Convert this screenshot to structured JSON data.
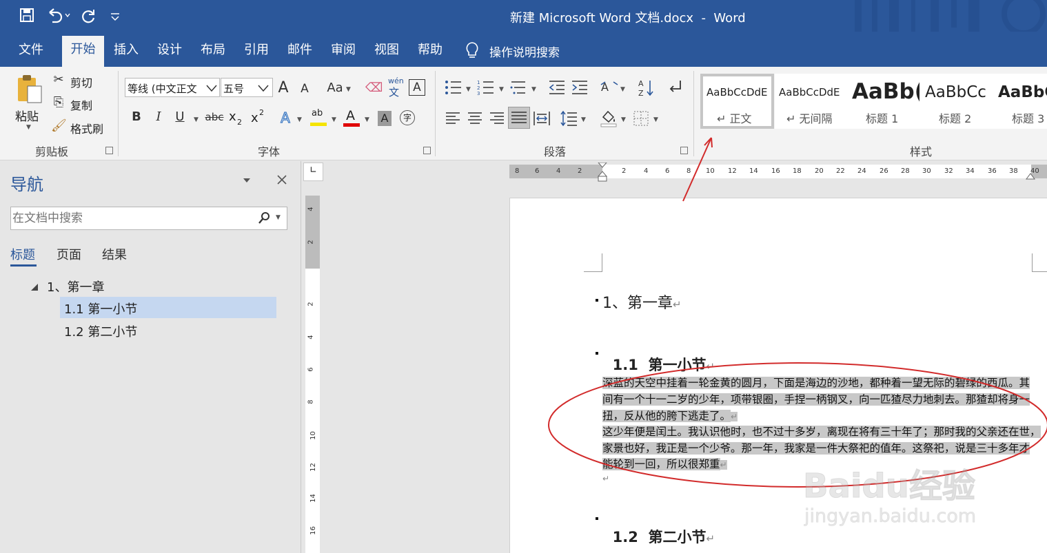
{
  "app": {
    "title": "新建 Microsoft Word 文档.docx  -  Word",
    "accent": "#2b579a"
  },
  "quick_access": {
    "save_icon": "save-icon",
    "undo_icon": "undo-icon",
    "redo_icon": "redo-icon",
    "customize_icon": "chevron-down-icon"
  },
  "tabs": [
    {
      "label": "文件"
    },
    {
      "label": "开始"
    },
    {
      "label": "插入"
    },
    {
      "label": "设计"
    },
    {
      "label": "布局"
    },
    {
      "label": "引用"
    },
    {
      "label": "邮件"
    },
    {
      "label": "审阅"
    },
    {
      "label": "视图"
    },
    {
      "label": "帮助"
    }
  ],
  "tell_me": "操作说明搜索",
  "ribbon": {
    "clipboard": {
      "group_label": "剪贴板",
      "paste": "粘贴",
      "cut": "剪切",
      "copy": "复制",
      "format_painter": "格式刷"
    },
    "font": {
      "group_label": "字体",
      "font_name": "等线 (中文正文",
      "font_size": "五号",
      "grow": "A",
      "shrink": "A",
      "change_case": "Aa",
      "phonetic_top": "wén",
      "phonetic_bottom": "文",
      "char_border": "A",
      "bold": "B",
      "italic": "I",
      "underline": "U",
      "strike": "abc",
      "subscript": "x",
      "subscript_mark": "2",
      "superscript": "x",
      "superscript_mark": "2",
      "text_effects": "A",
      "highlight": "ab",
      "font_color": "A",
      "char_shading": "A",
      "enclose": "字"
    },
    "paragraph": {
      "group_label": "段落"
    },
    "styles": {
      "group_label": "样式",
      "items": [
        {
          "preview": "AaBbCcDdE",
          "name": "↵ 正文"
        },
        {
          "preview": "AaBbCcDdE",
          "name": "↵ 无间隔"
        },
        {
          "preview": "AaBb(",
          "name": "标题 1"
        },
        {
          "preview": "AaBbCc",
          "name": "标题 2"
        },
        {
          "preview": "AaBbC",
          "name": "标题 3"
        }
      ]
    }
  },
  "nav_pane": {
    "title": "导航",
    "search_placeholder": "在文档中搜索",
    "tabs": [
      {
        "label": "标题"
      },
      {
        "label": "页面"
      },
      {
        "label": "结果"
      }
    ],
    "tree": [
      {
        "label": "1、第一章"
      },
      {
        "label": "1.1 第一小节"
      },
      {
        "label": "1.2 第二小节"
      }
    ]
  },
  "ruler": {
    "h_ticks": [
      "8",
      "6",
      "4",
      "2",
      "2",
      "4",
      "6",
      "8",
      "10",
      "12",
      "14",
      "16",
      "18",
      "20",
      "22",
      "24",
      "26",
      "28",
      "30",
      "32",
      "34",
      "36",
      "38",
      "40"
    ],
    "v_ticks": [
      "4",
      "2",
      "2",
      "4",
      "6",
      "8",
      "10",
      "12",
      "14",
      "16"
    ],
    "tab_stop": "∟"
  },
  "document": {
    "heading1": "1、第一章",
    "heading2a": "1.1  第一小节",
    "heading2b": "1.2  第二小节",
    "mark": "↵",
    "para1_lines": [
      "深蓝的天空中挂着一轮金黄的圆月，下面是海边的沙地，都种着一望无际的碧绿的西瓜。其",
      "间有一个十一二岁的少年，项带银圈，手捏一柄钢叉，向一匹猹尽力地刺去。那猹却将身一",
      "扭，反从他的胯下逃走了。"
    ],
    "para2_lines": [
      "这少年便是闰土。我认识他时，也不过十多岁，离现在将有三十年了；那时我的父亲还在世，",
      "家景也好，我正是一个少爷。那一年，我家是一件大祭祀的值年。这祭祀，说是三十多年才",
      "能轮到一回，所以很郑重"
    ]
  },
  "annotation_color": "#d22b2b",
  "watermark": {
    "logo": "Baidu经验",
    "url": "jingyan.baidu.com"
  }
}
